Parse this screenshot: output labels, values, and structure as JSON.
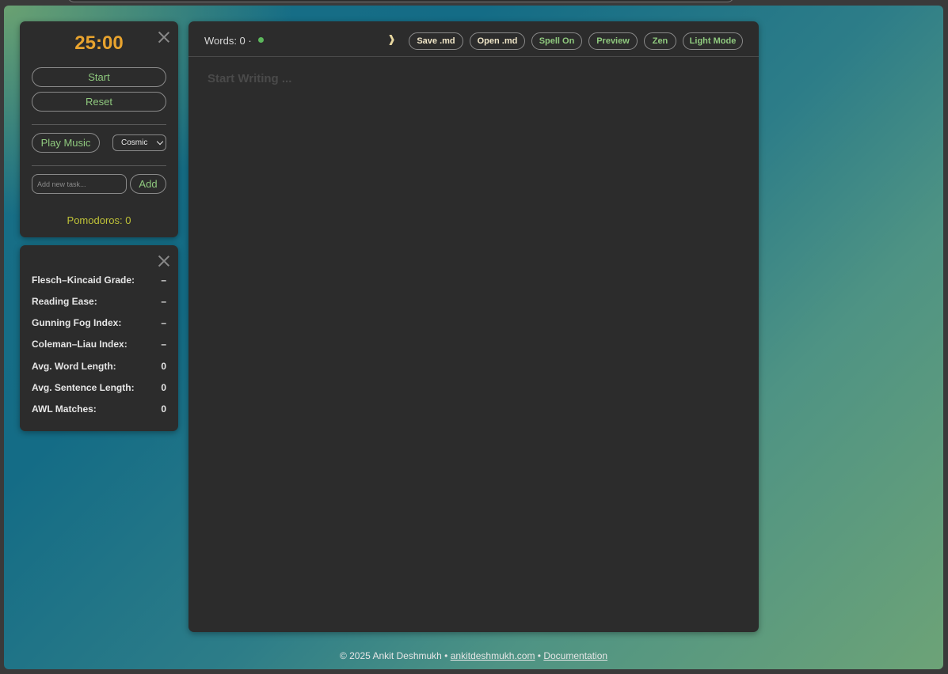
{
  "pomodoro_panel": {
    "timer": "25:00",
    "start_label": "Start",
    "reset_label": "Reset",
    "play_music_label": "Play Music",
    "music_select_value": "Cosmic",
    "task_placeholder": "Add new task...",
    "add_label": "Add",
    "pomodoros_label": "Pomodoros: 0"
  },
  "stats_panel": {
    "rows": [
      {
        "label": "Flesch–Kincaid Grade:",
        "value": "–"
      },
      {
        "label": "Reading Ease:",
        "value": "–"
      },
      {
        "label": "Gunning Fog Index:",
        "value": "–"
      },
      {
        "label": "Coleman–Liau Index:",
        "value": "–"
      },
      {
        "label": "Avg. Word Length:",
        "value": "0"
      },
      {
        "label": "Avg. Sentence Length:",
        "value": "0"
      },
      {
        "label": "AWL Matches:",
        "value": "0"
      }
    ]
  },
  "editor": {
    "words_label": "Words: 0 ·",
    "collapse_icon": "❱",
    "buttons": {
      "save": "Save .md",
      "open": "Open .md",
      "spell": "Spell On",
      "preview": "Preview",
      "zen": "Zen",
      "light_mode": "Light Mode"
    },
    "placeholder": "Start Writing ..."
  },
  "footer": {
    "copyright": "© 2025 Ankit Deshmukh •",
    "site_link": "ankitdeshmukh.com",
    "separator": "•",
    "docs_link": "Documentation"
  },
  "colors": {
    "timer": "#e8a32e",
    "accent_green": "#8fc97e",
    "pomodoros": "#bfc238",
    "panel_bg": "#2c2c2c"
  },
  "icons": {
    "close": "close-icon",
    "chevron": "chevron-down-icon",
    "collapse": "chevron-right-icon",
    "status": "status-dot-icon"
  }
}
